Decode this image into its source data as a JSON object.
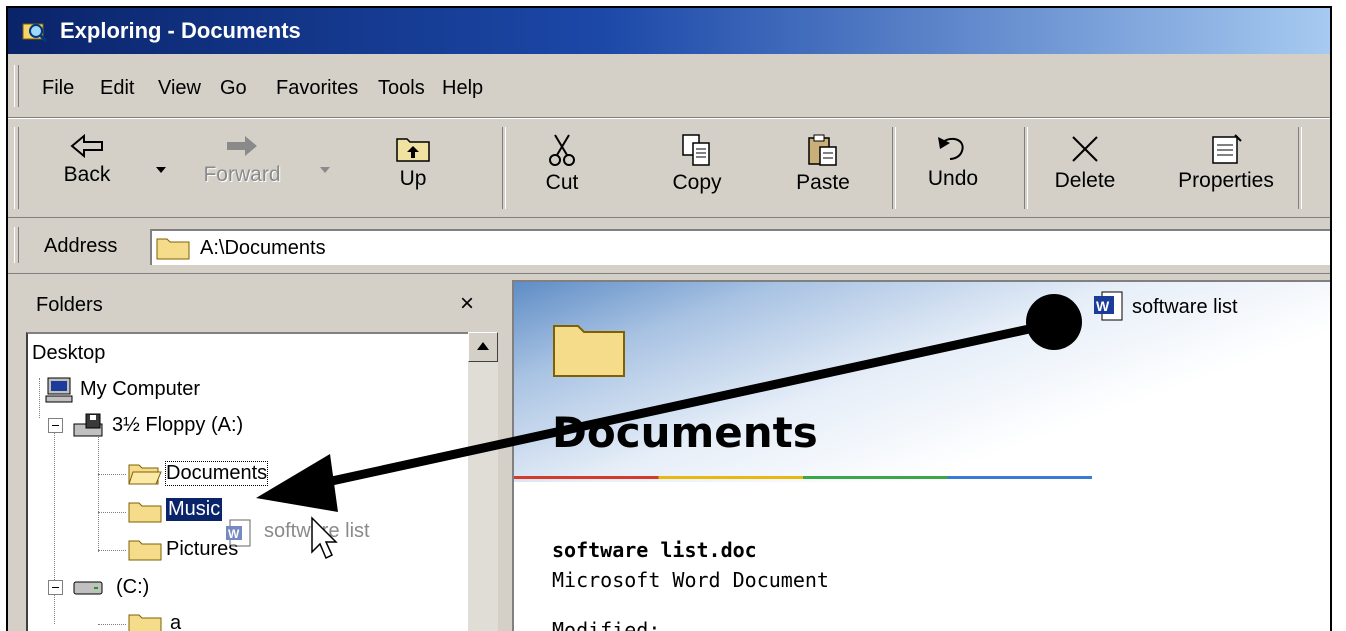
{
  "window": {
    "title": "Exploring - Documents"
  },
  "menu": [
    "File",
    "Edit",
    "View",
    "Go",
    "Favorites",
    "Tools",
    "Help"
  ],
  "toolbar": {
    "back": "Back",
    "forward": "Forward",
    "up": "Up",
    "cut": "Cut",
    "copy": "Copy",
    "paste": "Paste",
    "undo": "Undo",
    "delete": "Delete",
    "properties": "Properties"
  },
  "address": {
    "label": "Address",
    "value": "A:\\Documents"
  },
  "folders": {
    "title": "Folders",
    "close": "×",
    "tree": {
      "desktop": "Desktop",
      "my_computer": "My Computer",
      "floppy": "3½ Floppy (A:)",
      "documents": "Documents",
      "music": "Music",
      "pictures": "Pictures",
      "c_drive": "(C:)",
      "a_folder": "a"
    },
    "drag_ghost": "software list"
  },
  "content": {
    "folder_title": "Documents",
    "file_icon_label": "software list",
    "selected_name": "software list.doc",
    "selected_type": "Microsoft Word Document",
    "modified_label": "Modified:"
  },
  "colors": {
    "title_start": "#0a246a",
    "title_end": "#a6caf0",
    "selection": "#0a246a",
    "face": "#d4d0c8"
  },
  "annotation": {
    "arrow_color": "#000000",
    "meaning": "drag from file to Music folder"
  }
}
